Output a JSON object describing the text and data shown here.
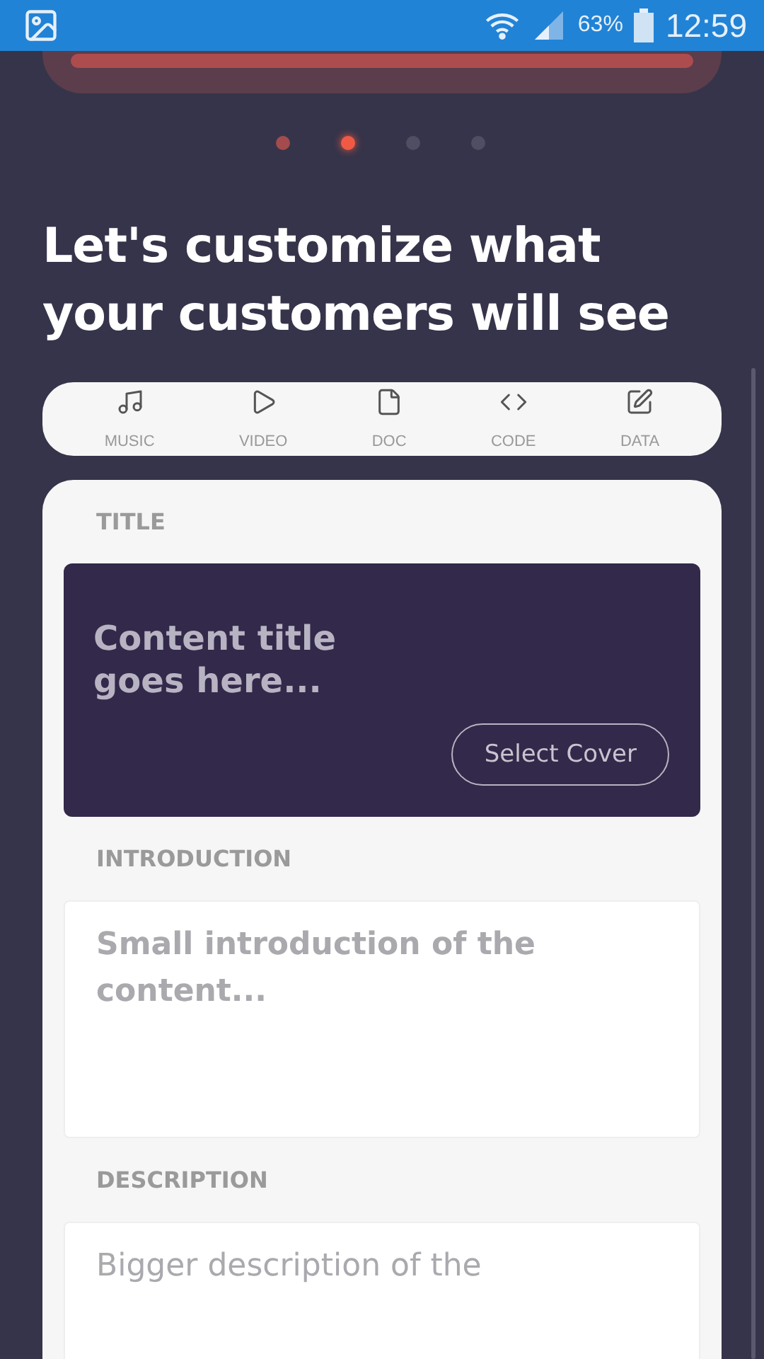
{
  "status_bar": {
    "battery": "63%",
    "time": "12:59"
  },
  "pager": [
    {
      "selected": false,
      "done": true
    },
    {
      "selected": true,
      "done": false
    },
    {
      "selected": false,
      "done": false
    },
    {
      "selected": false,
      "done": false
    }
  ],
  "heading": "Let's customize what your customers will see",
  "content_types": [
    {
      "kind": "music",
      "label": "MUSIC"
    },
    {
      "kind": "video",
      "label": "VIDEO"
    },
    {
      "kind": "doc",
      "label": "DOC"
    },
    {
      "kind": "code",
      "label": "CODE"
    },
    {
      "kind": "data",
      "label": "DATA"
    }
  ],
  "form": {
    "title_label": "TITLE",
    "title_placeholder": "Content title goes here...",
    "cover_button": "Select Cover",
    "intro_label": "INTRODUCTION",
    "intro_placeholder": "Small introduction of the content...",
    "description_label": "DESCRIPTION",
    "description_placeholder": "Bigger description of the"
  }
}
